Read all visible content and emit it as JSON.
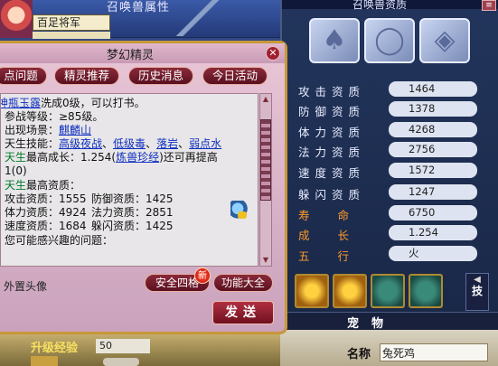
{
  "background": {
    "top_title": "召唤兽属性",
    "name_box": "百足将军",
    "level_label": "升级经验",
    "level_value": "50"
  },
  "dialog": {
    "title": "梦幻精灵",
    "close_glyph": "✕",
    "tabs": [
      "点问题",
      "精灵推荐",
      "历史消息",
      "今日活动"
    ],
    "content": {
      "line1_link": "神瓶玉露",
      "line1_rest": "洗成0级，可以打书。",
      "line2": "参战等级：≥85级。",
      "line3_label": "出现场景：",
      "line3_link": "麒麟山",
      "line4_label": "天生技能：",
      "line4_links": [
        "高级夜战",
        "低级毒",
        "落岩",
        "弱点水"
      ],
      "line5_green": "天生",
      "line5_a": "最高成长：1.254(",
      "line5_link": "炼兽珍经",
      "line5_b": ")还可再提高",
      "line6": "1(0)",
      "line7_green": "天生",
      "line7_rest": "最高资质：",
      "aptitudes": [
        {
          "label": "攻击资质：",
          "value": "1555",
          "label2": "防御资质：",
          "value2": "1425"
        },
        {
          "label": "体力资质：",
          "value": "4924",
          "label2": "法力资质：",
          "value2": "2851"
        },
        {
          "label": "速度资质：",
          "value": "1684",
          "label2": "躲闪资质：",
          "value2": "1425"
        }
      ],
      "last_line": "您可能感兴趣的问题："
    },
    "ext_label": "外置头像",
    "buttons": {
      "four_grid": "安全四格",
      "new_badge": "新",
      "features": "功能大全",
      "send": "发送"
    }
  },
  "pet_panel": {
    "title": "召唤兽资质",
    "menu_glyph": "≡",
    "equipment_icons": [
      "armor-icon",
      "ring-icon",
      "collar-icon"
    ],
    "stats": [
      {
        "label": "攻击资质",
        "value": "1464"
      },
      {
        "label": "防御资质",
        "value": "1378"
      },
      {
        "label": "体力资质",
        "value": "4268"
      },
      {
        "label": "法力资质",
        "value": "2756"
      },
      {
        "label": "速度资质",
        "value": "1572"
      },
      {
        "label": "躲闪资质",
        "value": "1247"
      },
      {
        "label": "寿命",
        "value": "6750"
      },
      {
        "label": "成长",
        "value": "1.254"
      },
      {
        "label": "五行",
        "value": "火"
      }
    ],
    "scroll_arrow": "◀",
    "scroll_label": "技",
    "tab_label": "宠物",
    "name_label": "名称",
    "name_value": "兔死鸡"
  },
  "colors": {
    "accent_orange": "#ff9a2a",
    "button_red": "#8a2a3a",
    "link_blue": "#1030c0",
    "green_text": "#007a2a"
  }
}
